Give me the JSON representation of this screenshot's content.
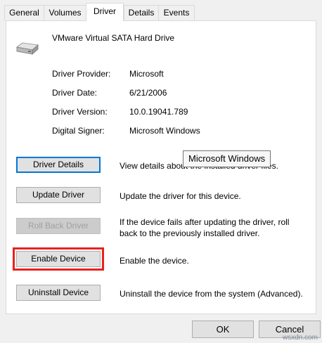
{
  "tabs": [
    {
      "label": "General"
    },
    {
      "label": "Volumes"
    },
    {
      "label": "Driver"
    },
    {
      "label": "Details"
    },
    {
      "label": "Events"
    }
  ],
  "device": {
    "name": "VMware Virtual SATA Hard Drive",
    "icon": "hard-drive-icon"
  },
  "properties": [
    {
      "label": "Driver Provider:",
      "value": "Microsoft"
    },
    {
      "label": "Driver Date:",
      "value": "6/21/2006"
    },
    {
      "label": "Driver Version:",
      "value": "10.0.19041.789"
    },
    {
      "label": "Digital Signer:",
      "value": "Microsoft Windows"
    }
  ],
  "tooltip": "Microsoft Windows",
  "actions": [
    {
      "button": "Driver Details",
      "description": "View details about the installed driver files."
    },
    {
      "button": "Update Driver",
      "description": "Update the driver for this device."
    },
    {
      "button": "Roll Back Driver",
      "description": "If the device fails after updating the driver, roll back to the previously installed driver."
    },
    {
      "button": "Enable Device",
      "description": "Enable the device."
    },
    {
      "button": "Uninstall Device",
      "description": "Uninstall the device from the system (Advanced)."
    }
  ],
  "footer": {
    "ok": "OK",
    "cancel": "Cancel"
  },
  "watermark": "wsxdn.com",
  "colors": {
    "highlight": "#e8211e",
    "focus": "#0078d7"
  }
}
